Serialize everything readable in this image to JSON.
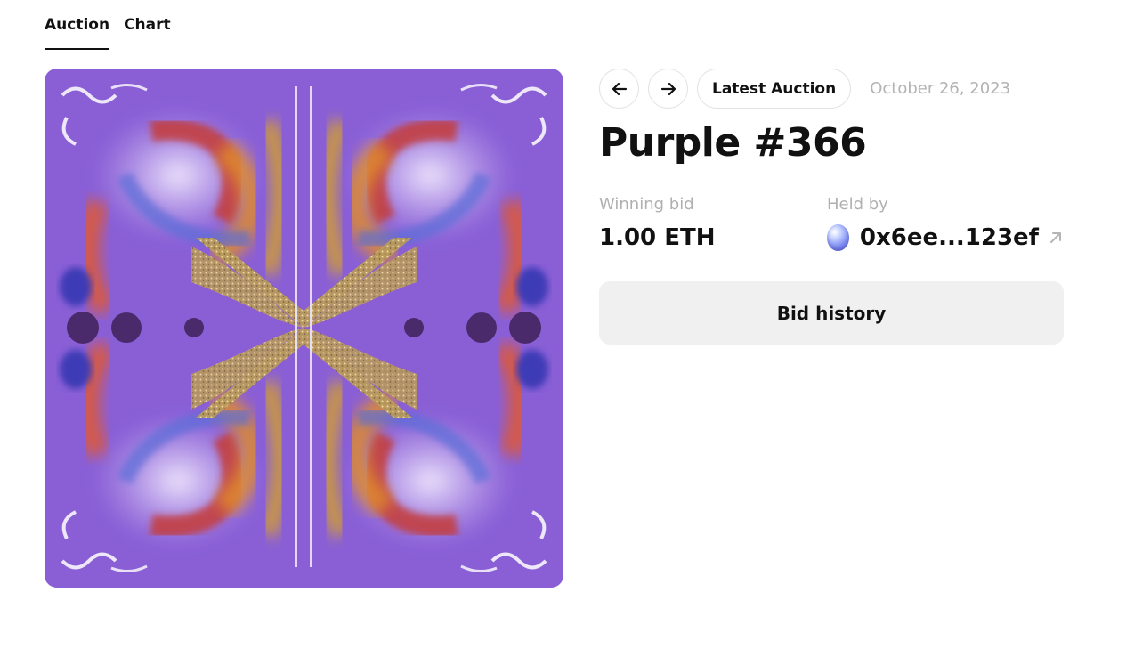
{
  "tabs": [
    {
      "label": "Auction",
      "active": true
    },
    {
      "label": "Chart",
      "active": false
    }
  ],
  "artwork": {
    "description_icon": "kaleidoscope-artwork",
    "background_color": "#8a5fd6"
  },
  "nav": {
    "prev_icon": "arrow-left-icon",
    "next_icon": "arrow-right-icon",
    "latest_label": "Latest Auction",
    "date": "October 26, 2023"
  },
  "title": "Purple #366",
  "winning_bid": {
    "label": "Winning bid",
    "value": "1.00 ETH"
  },
  "held_by": {
    "label": "Held by",
    "address": "0x6ee...123ef",
    "link_icon": "external-link-icon"
  },
  "bid_history_label": "Bid history"
}
